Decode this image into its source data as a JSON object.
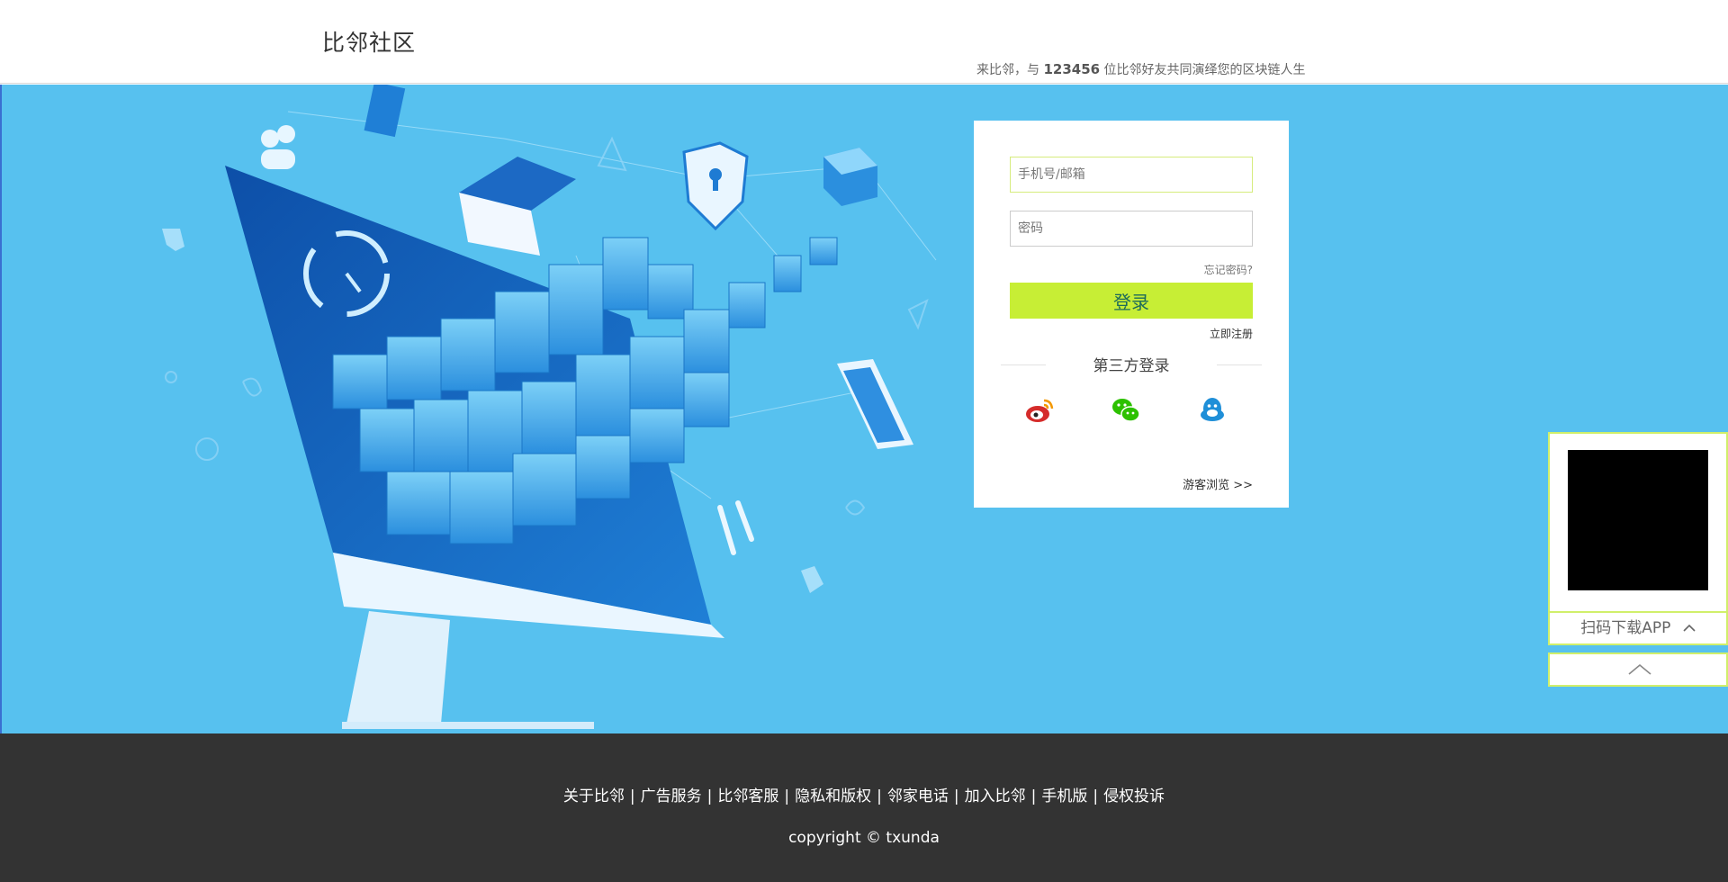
{
  "header": {
    "logo": "比邻社区",
    "tagline_prefix": "来比邻，与",
    "tagline_count": "123456",
    "tagline_suffix": "位比邻好友共同演绎您的区块链人生"
  },
  "login": {
    "phone_placeholder": "手机号/邮箱",
    "password_placeholder": "密码",
    "forgot": "忘记密码?",
    "submit": "登录",
    "register": "立即注册",
    "third_party_title": "第三方登录",
    "social_icons": [
      "weibo-icon",
      "wechat-icon",
      "qq-icon"
    ],
    "guest": "游客浏览 >>"
  },
  "footer": {
    "links": [
      "关于比邻",
      "广告服务",
      "比邻客服",
      "隐私和版权",
      "邻家电话",
      "加入比邻",
      "手机版",
      "侵权投诉"
    ],
    "copyright": "copyright © txunda"
  },
  "side": {
    "download_label": "扫码下载APP",
    "chevron_icon": "chevron-up-icon",
    "top_icon": "chevron-up-icon"
  },
  "colors": {
    "hero_bg": "#57c1ef",
    "accent_green": "#c7ee35",
    "button_text": "#1e6b5a",
    "footer_bg": "#333333",
    "weibo": "#d52c2b",
    "wechat": "#2dc100",
    "qq": "#1f8fd8"
  }
}
